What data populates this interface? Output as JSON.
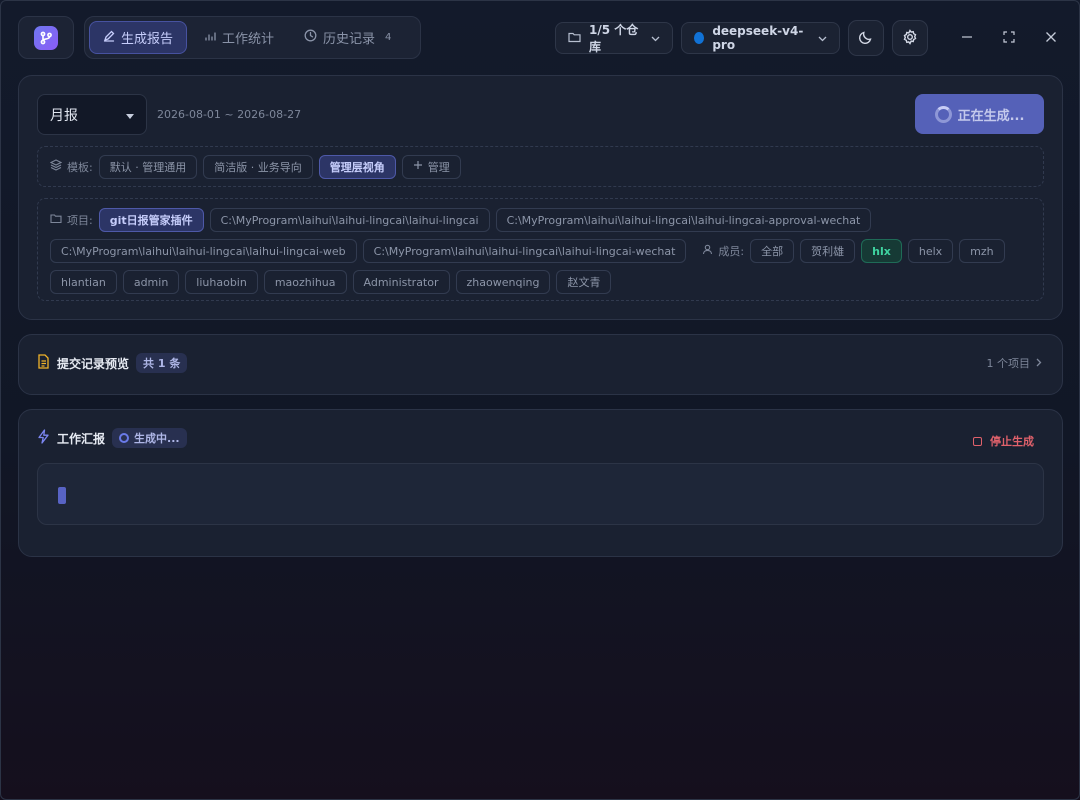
{
  "nav": {
    "tabs": [
      {
        "label": "生成报告",
        "icon": "pencil-icon",
        "active": true
      },
      {
        "label": "工作统计",
        "icon": "bar-chart-icon",
        "active": false
      },
      {
        "label": "历史记录",
        "icon": "clock-icon",
        "active": false,
        "count": "4"
      }
    ]
  },
  "toolbar": {
    "repo_label": "1/5 个仓库",
    "model_label": "deepseek-v4-pro",
    "model_color": "#1172d6"
  },
  "generator": {
    "period": "月报",
    "date_range": "2026-08-01 ~ 2026-08-27",
    "button_label": "正在生成..."
  },
  "templates": {
    "label": "模板:",
    "items": [
      {
        "label": "默认 · 管理通用",
        "selected": false
      },
      {
        "label": "简洁版 · 业务导向",
        "selected": false
      },
      {
        "label": "管理层视角",
        "selected": true
      }
    ],
    "manage_label": "管理"
  },
  "projects": {
    "label": "项目:",
    "items": [
      {
        "label": "git日报管家插件",
        "selected": true
      },
      {
        "label": "C:\\MyProgram\\laihui\\laihui-lingcai\\laihui-lingcai",
        "selected": false
      },
      {
        "label": "C:\\MyProgram\\laihui\\laihui-lingcai\\laihui-lingcai-approval-wechat",
        "selected": false
      },
      {
        "label": "C:\\MyProgram\\laihui\\laihui-lingcai\\laihui-lingcai-web",
        "selected": false
      },
      {
        "label": "C:\\MyProgram\\laihui\\laihui-lingcai\\laihui-lingcai-wechat",
        "selected": false
      }
    ]
  },
  "members": {
    "label": "成员:",
    "items": [
      {
        "label": "全部",
        "selected": false
      },
      {
        "label": "贺利雄",
        "selected": false
      },
      {
        "label": "hlx",
        "selected": true
      },
      {
        "label": "helx",
        "selected": false
      },
      {
        "label": "mzh",
        "selected": false
      },
      {
        "label": "hlantian",
        "selected": false
      },
      {
        "label": "admin",
        "selected": false
      },
      {
        "label": "liuhaobin",
        "selected": false
      },
      {
        "label": "maozhihua",
        "selected": false
      },
      {
        "label": "Administrator",
        "selected": false
      },
      {
        "label": "zhaowenqing",
        "selected": false
      },
      {
        "label": "赵文青",
        "selected": false
      }
    ]
  },
  "commits": {
    "title": "提交记录预览",
    "count_badge": "共 1 条",
    "project_count": "1 个项目"
  },
  "report": {
    "title": "工作汇报",
    "status": "生成中...",
    "stop_label": "停止生成"
  },
  "colors": {
    "accent": "#5561b8",
    "selected_member": "#3fd3a0",
    "stop": "#e0616b",
    "commit_icon": "#f0b429",
    "bolt_icon": "#7c86f0"
  }
}
